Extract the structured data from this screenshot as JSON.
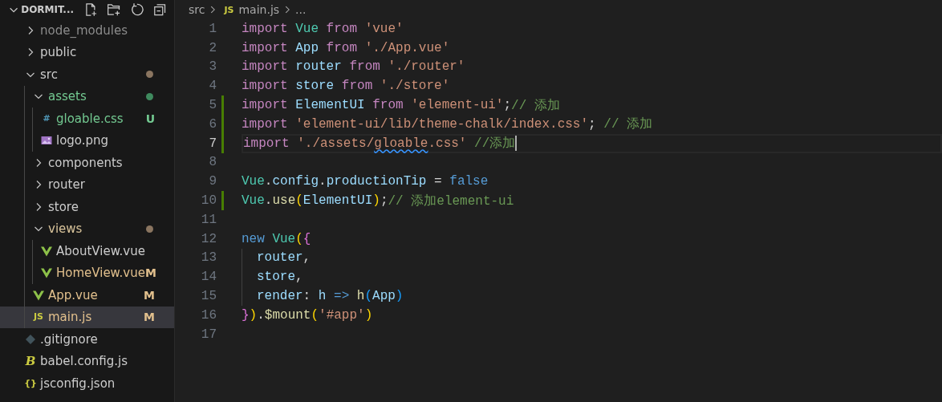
{
  "explorer": {
    "title": "DORMIT...",
    "expanded": true,
    "tree": [
      {
        "kind": "folder",
        "label": "node_modules",
        "expanded": false,
        "selected": false,
        "color": "#8b8b8b"
      },
      {
        "kind": "folder",
        "label": "public",
        "expanded": false,
        "selected": false,
        "color": "#cccccc"
      },
      {
        "kind": "folder",
        "label": "src",
        "expanded": true,
        "selected": false,
        "color": "#cccccc",
        "dot": {
          "color": "#8a7560"
        },
        "children": [
          {
            "kind": "folder",
            "label": "assets",
            "expanded": true,
            "selected": false,
            "color": "#73c991",
            "dot": {
              "color": "#3f8a5e"
            },
            "children": [
              {
                "kind": "glyph-file",
                "icon_label": "#",
                "label": "gloable.css",
                "selected": false,
                "color": "#73c991",
                "badge": "U"
              },
              {
                "kind": "image-file",
                "label": "logo.png",
                "selected": false,
                "color": "#cccccc"
              }
            ]
          },
          {
            "kind": "folder",
            "label": "components",
            "expanded": false,
            "selected": false,
            "color": "#cccccc"
          },
          {
            "kind": "folder",
            "label": "router",
            "expanded": false,
            "selected": false,
            "color": "#cccccc"
          },
          {
            "kind": "folder",
            "label": "store",
            "expanded": false,
            "selected": false,
            "color": "#cccccc"
          },
          {
            "kind": "folder",
            "label": "views",
            "expanded": true,
            "selected": false,
            "color": "#d8c39a",
            "dot": {
              "color": "#8a7560"
            },
            "children": [
              {
                "kind": "vue-file",
                "label": "AboutView.vue",
                "selected": false,
                "color": "#cccccc"
              },
              {
                "kind": "vue-file",
                "label": "HomeView.vue",
                "selected": false,
                "color": "#e2c08d",
                "badge": "M"
              }
            ]
          },
          {
            "kind": "vue-file",
            "label": "App.vue",
            "selected": false,
            "color": "#e2c08d",
            "badge": "M"
          },
          {
            "kind": "glyph-file",
            "icon_label": "JS",
            "label": "main.js",
            "selected": true,
            "color": "#e2c08d",
            "badge": "M"
          }
        ]
      },
      {
        "kind": "git-file",
        "label": ".gitignore",
        "selected": false,
        "color": "#cccccc"
      },
      {
        "kind": "glyph-file",
        "icon_label": "B",
        "label": "babel.config.js",
        "selected": false,
        "color": "#cccccc"
      },
      {
        "kind": "glyph-file",
        "icon_label": "{}",
        "label": "jsconfig.json",
        "selected": false,
        "color": "#cccccc"
      }
    ]
  },
  "breadcrumb": {
    "folder": "src",
    "file_icon": "JS",
    "file": "main.js",
    "more": "..."
  },
  "editor": {
    "lines": [
      {
        "number": "1",
        "current": false,
        "tokens": [
          {
            "kind": "kw",
            "t": "import"
          },
          {
            "kind": "cls",
            "t": " Vue"
          },
          {
            "kind": "kw",
            "t": " from"
          },
          {
            "kind": "str",
            "t": " 'vue'"
          }
        ]
      },
      {
        "number": "2",
        "current": false,
        "tokens": [
          {
            "kind": "kw",
            "t": "import"
          },
          {
            "kind": "var",
            "t": " App"
          },
          {
            "kind": "kw",
            "t": " from"
          },
          {
            "kind": "str",
            "t": " './App.vue'"
          }
        ]
      },
      {
        "number": "3",
        "current": false,
        "tokens": [
          {
            "kind": "kw",
            "t": "import"
          },
          {
            "kind": "var",
            "t": " router"
          },
          {
            "kind": "kw",
            "t": " from"
          },
          {
            "kind": "str",
            "t": " './router'"
          }
        ]
      },
      {
        "number": "4",
        "current": false,
        "tokens": [
          {
            "kind": "kw",
            "t": "import"
          },
          {
            "kind": "var",
            "t": " store"
          },
          {
            "kind": "kw",
            "t": " from"
          },
          {
            "kind": "str",
            "t": " './store'"
          }
        ]
      },
      {
        "number": "5",
        "modified": true,
        "current": false,
        "tokens": [
          {
            "kind": "kw",
            "t": "import"
          },
          {
            "kind": "var",
            "t": " ElementUI"
          },
          {
            "kind": "kw",
            "t": " from"
          },
          {
            "kind": "str",
            "t": " 'element-ui'"
          },
          {
            "kind": "p",
            "t": ";"
          },
          {
            "kind": "cm",
            "t": "// 添加"
          }
        ]
      },
      {
        "number": "6",
        "modified": true,
        "current": false,
        "tokens": [
          {
            "kind": "kw",
            "t": "import"
          },
          {
            "kind": "str",
            "t": " 'element-ui/lib/theme-chalk/index.css'"
          },
          {
            "kind": "p",
            "t": ";"
          },
          {
            "kind": "cm",
            "t": " // 添加"
          }
        ]
      },
      {
        "number": "7",
        "modified": true,
        "current": true,
        "tokens": [
          {
            "kind": "kw",
            "t": "import"
          },
          {
            "kind": "str",
            "t": " './assets/"
          },
          {
            "kind": "warnstr",
            "t": "gloable"
          },
          {
            "kind": "str",
            "t": ".css'"
          },
          {
            "kind": "cm",
            "t": " //添加"
          }
        ]
      },
      {
        "number": "8",
        "current": false
      },
      {
        "number": "9",
        "current": false,
        "tokens": [
          {
            "kind": "cls",
            "t": "Vue"
          },
          {
            "kind": "p",
            "t": "."
          },
          {
            "kind": "var",
            "t": "config"
          },
          {
            "kind": "p",
            "t": "."
          },
          {
            "kind": "var",
            "t": "productionTip"
          },
          {
            "kind": "p",
            "t": " ="
          },
          {
            "kind": "const",
            "t": " false"
          }
        ]
      },
      {
        "number": "10",
        "modified": true,
        "current": false,
        "tokens": [
          {
            "kind": "cls",
            "t": "Vue"
          },
          {
            "kind": "p",
            "t": "."
          },
          {
            "kind": "fn",
            "t": "use"
          },
          {
            "kind": "b1",
            "t": "("
          },
          {
            "kind": "var",
            "t": "ElementUI"
          },
          {
            "kind": "b1",
            "t": ")"
          },
          {
            "kind": "p",
            "t": ";"
          },
          {
            "kind": "cm",
            "t": "// 添加element-ui"
          }
        ]
      },
      {
        "number": "11",
        "current": false
      },
      {
        "number": "12",
        "current": false,
        "tokens": [
          {
            "kind": "const",
            "t": "new"
          },
          {
            "kind": "cls",
            "t": " Vue"
          },
          {
            "kind": "b1",
            "t": "("
          },
          {
            "kind": "b2",
            "t": "{"
          }
        ]
      },
      {
        "number": "13",
        "current": false,
        "indent": true,
        "tokens": [
          {
            "kind": "var",
            "t": "router"
          },
          {
            "kind": "p",
            "t": ","
          }
        ]
      },
      {
        "number": "14",
        "current": false,
        "indent": true,
        "tokens": [
          {
            "kind": "var",
            "t": "store"
          },
          {
            "kind": "p",
            "t": ","
          }
        ]
      },
      {
        "number": "15",
        "current": false,
        "indent": true,
        "tokens": [
          {
            "kind": "var",
            "t": "render"
          },
          {
            "kind": "p",
            "t": ":"
          },
          {
            "kind": "var",
            "t": " h"
          },
          {
            "kind": "const",
            "t": " =>"
          },
          {
            "kind": "fn",
            "t": " h"
          },
          {
            "kind": "b3",
            "t": "("
          },
          {
            "kind": "var",
            "t": "App"
          },
          {
            "kind": "b3",
            "t": ")"
          }
        ]
      },
      {
        "number": "16",
        "current": false,
        "tokens": [
          {
            "kind": "b2",
            "t": "}"
          },
          {
            "kind": "b1",
            "t": ")"
          },
          {
            "kind": "p",
            "t": "."
          },
          {
            "kind": "fn",
            "t": "$mount"
          },
          {
            "kind": "b1",
            "t": "("
          },
          {
            "kind": "str",
            "t": "'#app'"
          },
          {
            "kind": "b1",
            "t": ")"
          }
        ]
      },
      {
        "number": "17",
        "current": false
      }
    ]
  }
}
